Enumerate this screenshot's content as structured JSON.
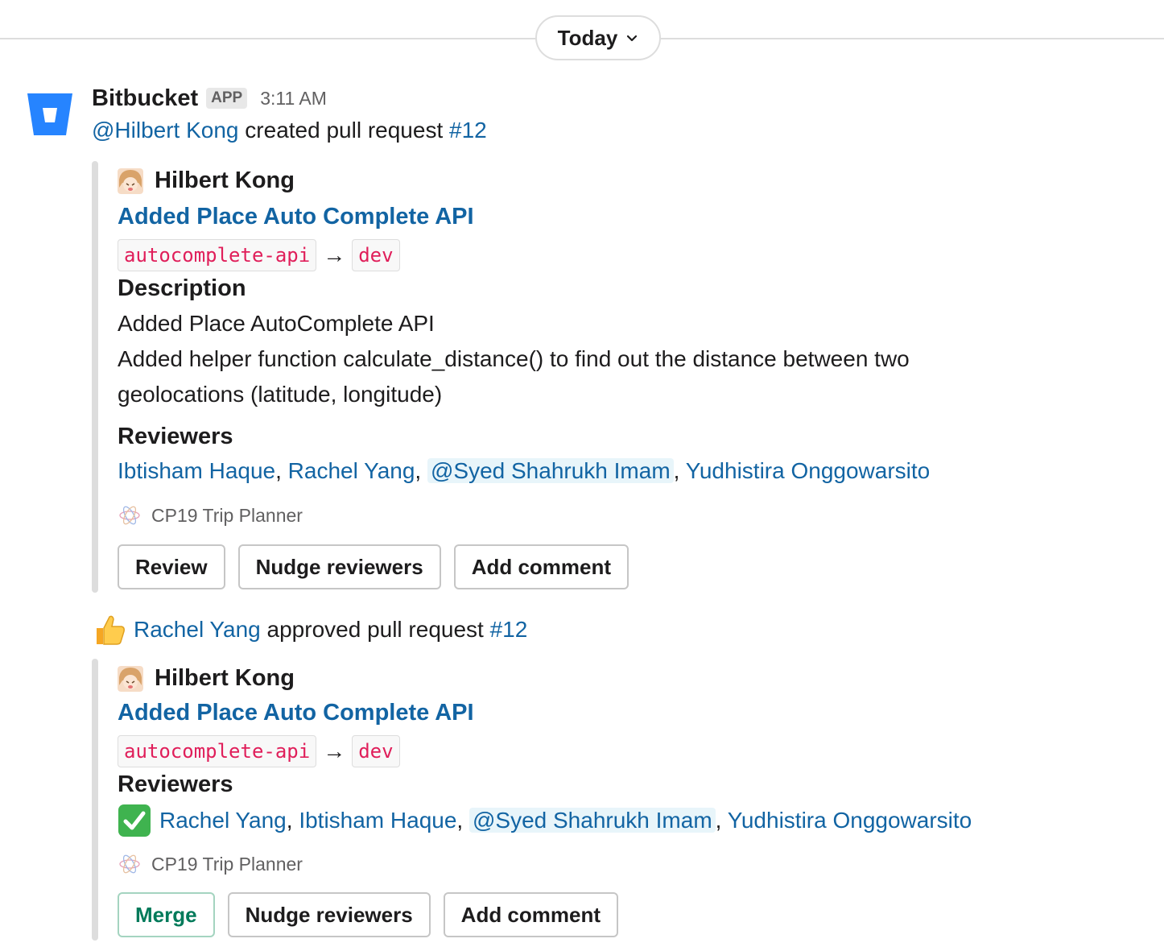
{
  "date_divider": {
    "label": "Today"
  },
  "message": {
    "sender": "Bitbucket",
    "badge": "APP",
    "time": "3:11 AM",
    "line": {
      "mention": "@Hilbert Kong",
      "text": " created pull request ",
      "pr_ref": "#12"
    }
  },
  "attachment1": {
    "author": "Hilbert Kong",
    "title": "Added Place Auto Complete API",
    "source_branch": "autocomplete-api",
    "arrow": "→",
    "target_branch": "dev",
    "description_title": "Description",
    "description_lines": [
      "Added Place AutoComplete API",
      "Added helper function calculate_distance() to find out the distance between two",
      "geolocations (latitude, longitude)"
    ],
    "reviewers_title": "Reviewers",
    "reviewers": [
      "Ibtisham Haque",
      "Rachel Yang",
      "@Syed Shahrukh Imam",
      "Yudhistira Onggowarsito"
    ],
    "separator": ", ",
    "footer": "CP19 Trip Planner",
    "buttons": [
      "Review",
      "Nudge reviewers",
      "Add comment"
    ]
  },
  "approval": {
    "user": "Rachel Yang",
    "text": " approved pull request ",
    "pr_ref": "#12"
  },
  "attachment2": {
    "author": "Hilbert Kong",
    "title": "Added Place Auto Complete API",
    "source_branch": "autocomplete-api",
    "arrow": "→",
    "target_branch": "dev",
    "reviewers_title": "Reviewers",
    "reviewers": [
      "Rachel Yang",
      "Ibtisham Haque",
      "@Syed Shahrukh Imam",
      "Yudhistira Onggowarsito"
    ],
    "separator": ", ",
    "footer": "CP19 Trip Planner",
    "buttons": [
      "Merge",
      "Nudge reviewers",
      "Add comment"
    ]
  },
  "icons": {
    "logo": "bitbucket-logo-icon",
    "chevron": "chevron-down-icon",
    "thumbs": "thumbs-up-icon",
    "check": "check-mark-icon",
    "project": "project-icon"
  },
  "colors": {
    "link": "#1264a3",
    "code": "#e01e5a",
    "merge": "#007a5a",
    "bitbucket": "#2684ff"
  }
}
